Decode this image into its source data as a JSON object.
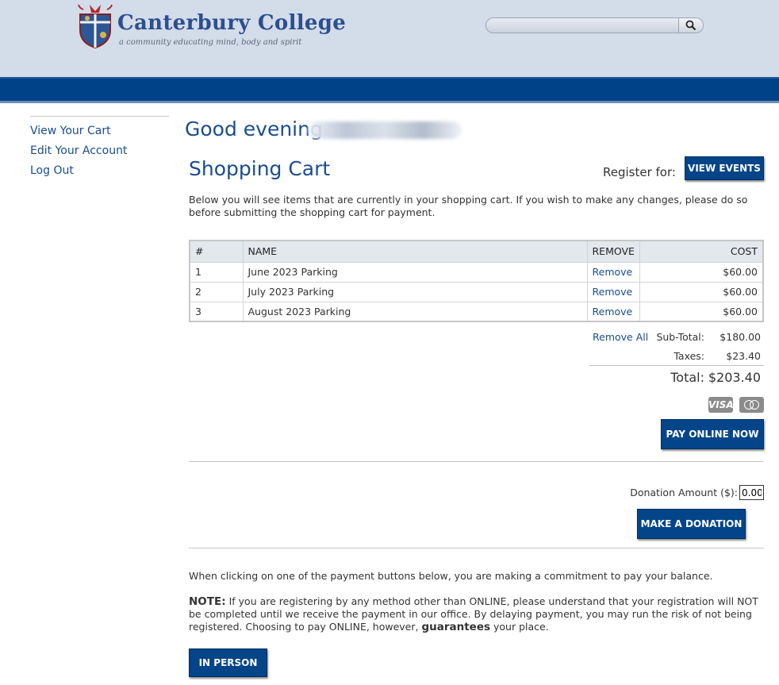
{
  "header": {
    "college_name": "Canterbury College",
    "tagline": "a community educating mind, body and spirit",
    "search": {
      "value": "",
      "placeholder": ""
    }
  },
  "sidebar": {
    "items": [
      {
        "label": "View Your Cart"
      },
      {
        "label": "Edit Your Account"
      },
      {
        "label": "Log Out"
      }
    ]
  },
  "main": {
    "greeting": "Good evening",
    "cart_title": "Shopping Cart",
    "register_label": "Register for:",
    "view_events_label": "VIEW EVENTS",
    "intro": "Below you will see items that are currently in your shopping cart. If you wish to make any changes, please do so before submitting the shopping cart for payment.",
    "table": {
      "headers": {
        "num": "#",
        "name": "NAME",
        "remove": "REMOVE",
        "cost": "COST"
      },
      "rows": [
        {
          "num": "1",
          "name": "June 2023 Parking",
          "remove": "Remove",
          "cost": "$60.00"
        },
        {
          "num": "2",
          "name": "July 2023 Parking",
          "remove": "Remove",
          "cost": "$60.00"
        },
        {
          "num": "3",
          "name": "August 2023 Parking",
          "remove": "Remove",
          "cost": "$60.00"
        }
      ]
    },
    "totals": {
      "remove_all": "Remove All",
      "subtotal_label": "Sub-Total:",
      "subtotal": "$180.00",
      "taxes_label": "Taxes:",
      "taxes": "$23.40",
      "total_label": "Total:",
      "total": "$203.40"
    },
    "cards": {
      "visa": "VISA"
    },
    "pay_online_label": "PAY ONLINE NOW",
    "donation": {
      "label": "Donation Amount ($):",
      "value": "0.00",
      "button_label": "MAKE A DONATION"
    },
    "commitment": "When clicking on one of the payment buttons below, you are making a commitment to pay your balance.",
    "note": {
      "prefix": "NOTE:",
      "text_before": " If you are registering by any method other than ONLINE, please understand that your registration will NOT be completed until we receive the payment in our office. By delaying payment, you may run the risk of not being registered. Choosing to pay ONLINE, however, ",
      "emphasis": "guarantees",
      "text_after": " your place."
    },
    "in_person_label": "IN PERSON"
  },
  "colors": {
    "header_bg": "#d3dce9",
    "navbar": "#004287",
    "link": "#1a4d8f",
    "button": "#04458a"
  }
}
